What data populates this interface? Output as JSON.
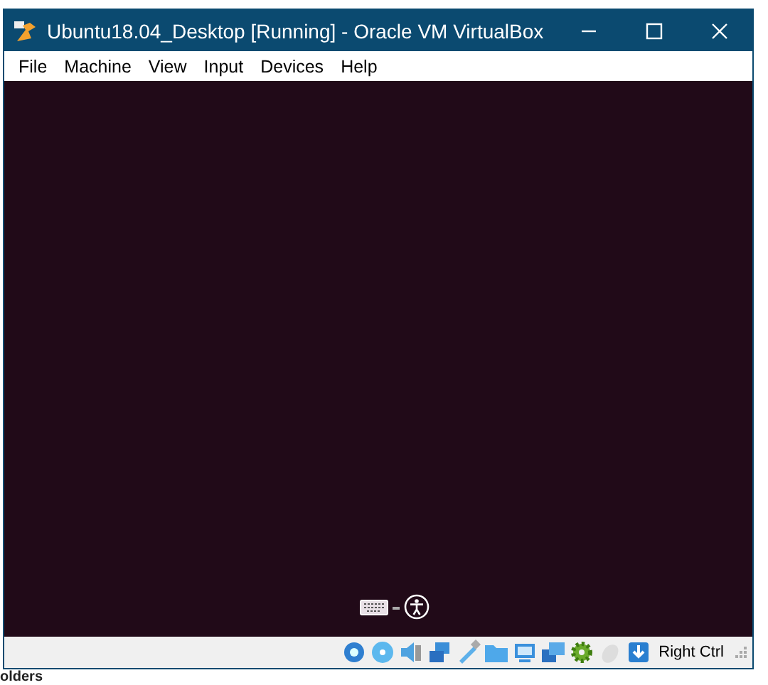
{
  "window": {
    "title": "Ubuntu18.04_Desktop [Running] - Oracle VM VirtualBox"
  },
  "menu": [
    "File",
    "Machine",
    "View",
    "Input",
    "Devices",
    "Help"
  ],
  "status_bar": {
    "host_key": "Right Ctrl"
  },
  "background_text": "olders"
}
